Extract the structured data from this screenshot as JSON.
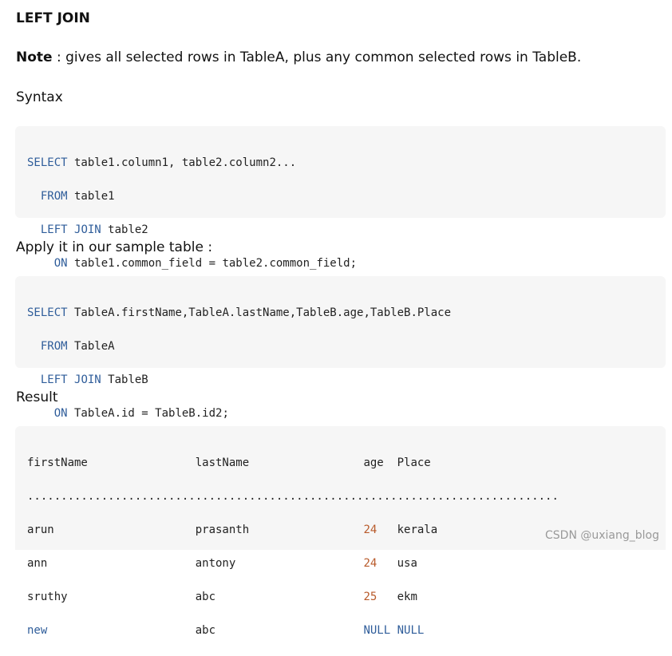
{
  "heading": "LEFT JOIN",
  "note": {
    "label": "Note",
    "text": " : gives all selected rows in TableA, plus any common selected rows in TableB."
  },
  "syntax_label": "Syntax",
  "syntax_code": {
    "l1": {
      "kw": "SELECT",
      "rest": " table1.column1, table2.column2..."
    },
    "l2": {
      "indent": "  ",
      "kw": "FROM",
      "rest": " table1"
    },
    "l3": {
      "indent": "  ",
      "kw1": "LEFT",
      "sp": " ",
      "kw2": "JOIN",
      "rest": " table2"
    },
    "l4": {
      "indent": "    ",
      "kw": "ON",
      "rest": " table1.common_field = table2.common_field;"
    }
  },
  "apply_label": "Apply it in our sample table :",
  "sample_code": {
    "l1": {
      "kw": "SELECT",
      "rest": " TableA.firstName,TableA.lastName,TableB.age,TableB.Place"
    },
    "l2": {
      "indent": "  ",
      "kw": "FROM",
      "rest": " TableA"
    },
    "l3": {
      "indent": "  ",
      "kw1": "LEFT",
      "sp": " ",
      "kw2": "JOIN",
      "rest": " TableB"
    },
    "l4": {
      "indent": "    ",
      "kw": "ON",
      "rest": " TableA.id = TableB.id2;"
    }
  },
  "result_label": "Result",
  "result": {
    "header": {
      "first": "firstName                ",
      "last": "lastName                 ",
      "age": "age  ",
      "place": "Place"
    },
    "separator": "...............................................................................",
    "rows": [
      {
        "first": "arun                     ",
        "last": "prasanth                 ",
        "age": "24",
        "place": "   kerala"
      },
      {
        "first": "ann                      ",
        "last": "antony                   ",
        "age": "24",
        "place": "   usa"
      },
      {
        "first": "sruthy                   ",
        "last": "abc                      ",
        "age": "25",
        "place": "   ekm"
      },
      {
        "first": "new",
        "firstpad": "                      ",
        "last": "abc                      ",
        "age": "NULL",
        "place": " NULL"
      }
    ]
  },
  "watermark": "CSDN @uxiang_blog"
}
